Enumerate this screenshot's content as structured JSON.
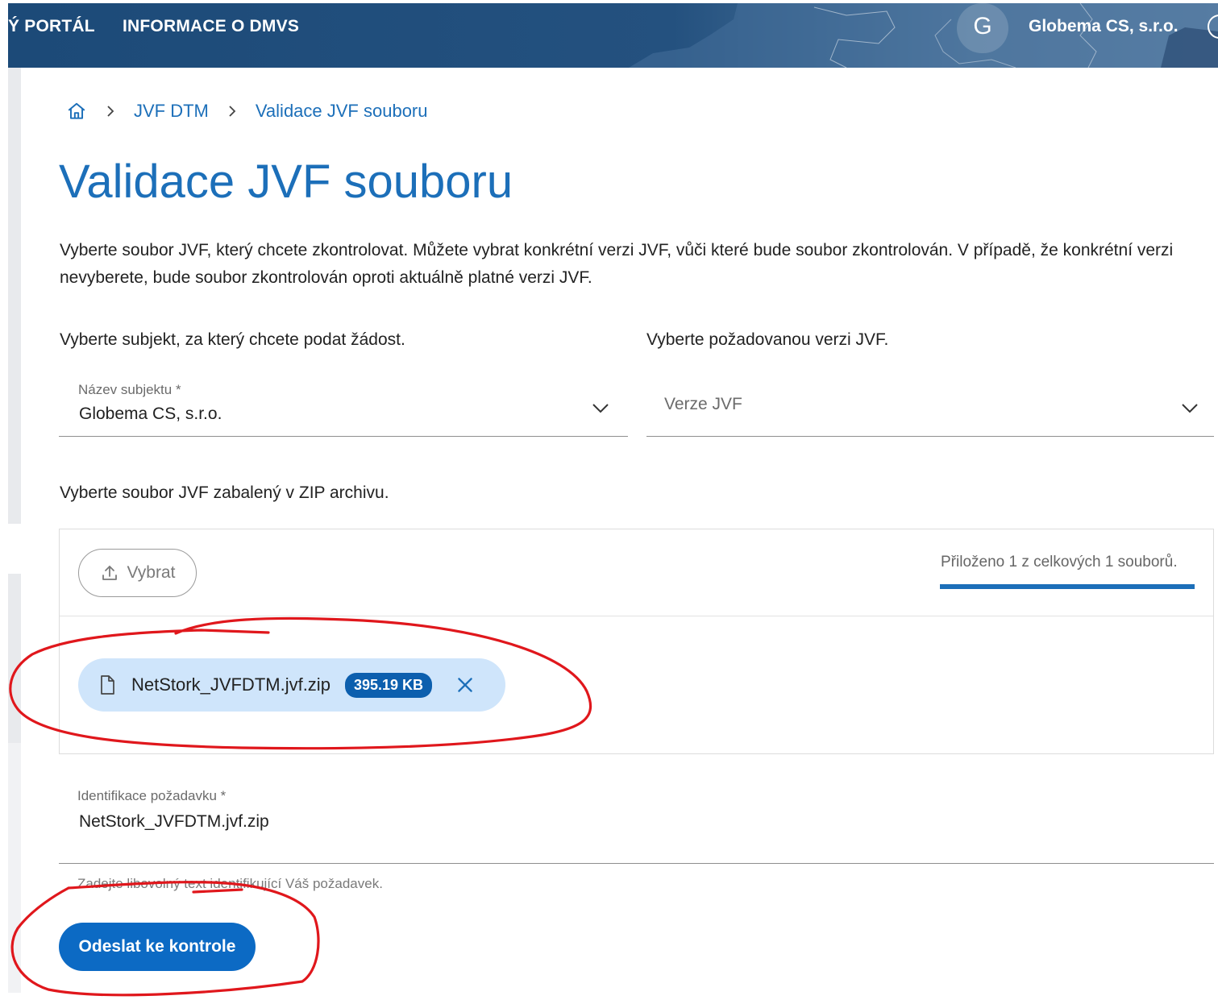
{
  "header": {
    "nav_portal": "Ý PORTÁL",
    "nav_info": "INFORMACE O DMVS",
    "avatar_letter": "G",
    "user_name": "Globema CS, s.r.o."
  },
  "breadcrumb": {
    "items": [
      "JVF DTM",
      "Validace JVF souboru"
    ]
  },
  "page": {
    "title": "Validace JVF souboru",
    "description": "Vyberte soubor JVF, který chcete zkontrolovat. Můžete vybrat konkrétní verzi JVF, vůči které bude soubor zkontrolován. V případě, že konkrétní verzi nevyberete, bude soubor zkontrolován oproti aktuálně platné verzi JVF."
  },
  "subject": {
    "prompt": "Vyberte subjekt, za který chcete podat žádost.",
    "label": "Název subjektu *",
    "value": "Globema CS, s.r.o."
  },
  "version": {
    "prompt": "Vyberte požadovanou verzi JVF.",
    "placeholder": "Verze JVF"
  },
  "upload": {
    "prompt": "Vyberte soubor JVF zabalený v ZIP archivu.",
    "pick_label": "Vybrat",
    "counter_text": "Přiloženo 1 z celkových 1 souborů.",
    "progress": 1.0,
    "file": {
      "name": "NetStork_JVFDTM.jvf.zip",
      "size": "395.19 KB"
    }
  },
  "identification": {
    "label": "Identifikace požadavku *",
    "value": "NetStork_JVFDTM.jvf.zip",
    "hint": "Zadejte libovolný text identifikující Váš požadavek."
  },
  "submit": {
    "label": "Odeslat ke kontrole"
  },
  "colors": {
    "primary": "#1c6fb9",
    "header": "#1c4a78",
    "chip": "#cfe5fb",
    "badge": "#0c5fae",
    "annotation": "#e0171c"
  },
  "icons": {
    "home": "home-icon",
    "chevron_right": "chevron-right-icon",
    "chevron_down": "chevron-down-icon",
    "upload": "upload-icon",
    "file": "file-icon",
    "close": "close-icon",
    "account": "account-icon"
  }
}
